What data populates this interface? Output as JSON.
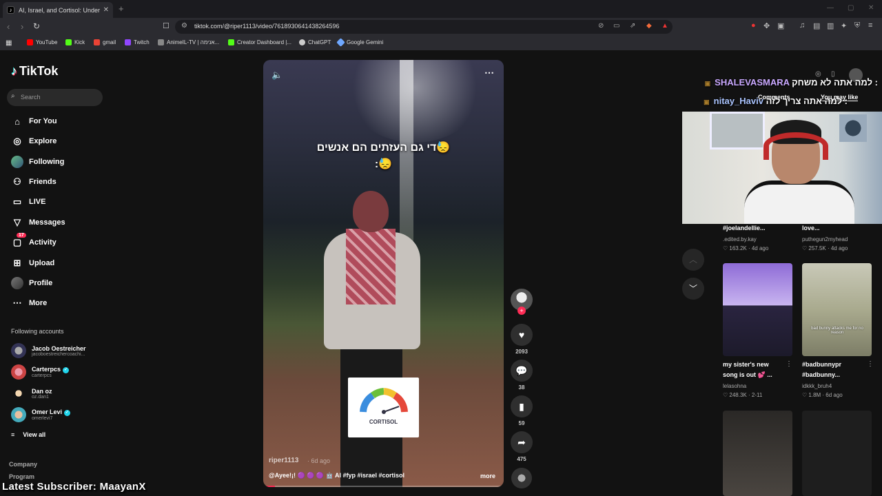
{
  "browser": {
    "tab_title": "AI, Israel, and Cortisol: Under",
    "url": "tiktok.com/@riper1113/video/7618930641438264596",
    "bookmarks": [
      "YouTube",
      "Kick",
      "gmail",
      "Twitch",
      "AnimeIL-TV | אנימה...",
      "Creator Dashboard |...",
      "ChatGPT",
      "Google Gemini"
    ]
  },
  "sidebar": {
    "logo": "TikTok",
    "search_placeholder": "Search",
    "menu": [
      {
        "label": "For You",
        "icon": "home-icon"
      },
      {
        "label": "Explore",
        "icon": "compass-icon"
      },
      {
        "label": "Following",
        "icon": "avatar"
      },
      {
        "label": "Friends",
        "icon": "friends-icon"
      },
      {
        "label": "LIVE",
        "icon": "live-icon"
      },
      {
        "label": "Messages",
        "icon": "messages-icon"
      },
      {
        "label": "Activity",
        "icon": "activity-icon",
        "badge": "17"
      },
      {
        "label": "Upload",
        "icon": "upload-icon"
      },
      {
        "label": "Profile",
        "icon": "avatar"
      },
      {
        "label": "More",
        "icon": "more-icon"
      }
    ],
    "following_title": "Following accounts",
    "following": [
      {
        "name": "Jacob Oestreicher",
        "handle": "jacoboestreichercoachi...",
        "verified": false
      },
      {
        "name": "Carterpcs",
        "handle": "carterpcs",
        "verified": true
      },
      {
        "name": "Dan oz",
        "handle": "oz.dan1",
        "verified": false
      },
      {
        "name": "Omer Levi",
        "handle": "omerlevi7",
        "verified": true
      }
    ],
    "view_all": "View all",
    "footer": [
      "Company",
      "Program"
    ]
  },
  "video": {
    "caption_line1": "די גם העזתים הם אנשים😓",
    "caption_line2": ":😓",
    "gauge_label": "CORTISOL",
    "author": "riper1113",
    "date": "· 6d ago",
    "description": "@Ayee!¡! 🟣 🟣 🟣 🤖 AI #fyp #israel #cortisol",
    "more": "more",
    "progress": 0.05,
    "likes": "2093",
    "comments": "38",
    "saves": "59",
    "shares": "475"
  },
  "right_panel": {
    "tabs": [
      "Comments",
      "You may like"
    ],
    "chat": [
      {
        "user": "SHALEVASMARA",
        "message": "למה אתה לא משחק :"
      },
      {
        "user": "nitay_Haviv",
        "message": "למה אתה צריך לזה :"
      }
    ],
    "cards_top": [
      {
        "title": "#joelandellie...",
        "user": ".edited.by.kay",
        "stats": "♡ 163.2K · 4d ago"
      },
      {
        "title": "love...",
        "user": "puthegun2myhead",
        "stats": "♡ 257.5K · 4d ago"
      }
    ],
    "cards": [
      {
        "title1": "my sister's new",
        "title2": "song is out 💕 ...",
        "user": "lelasohna",
        "stats": "♡ 248.3K · 2-11"
      },
      {
        "title1": "#badbunnypr",
        "title2": "#badbunny...",
        "user": "idkkk_bruh4",
        "stats": "♡ 1.8M · 6d ago"
      }
    ],
    "thumb_caption": "bad bunny attacks me for no reason"
  },
  "overlay": {
    "latest_subscriber": "Latest Subscriber: MaayanX"
  }
}
